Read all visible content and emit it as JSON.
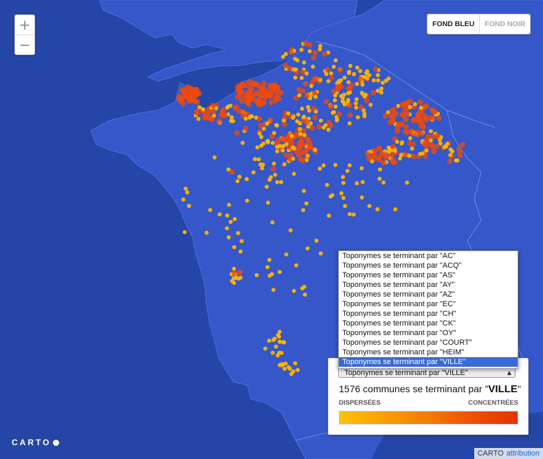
{
  "map": {
    "sea_color": "#2446a8",
    "land_color": "#3557c9",
    "border_color": "#5a7ad8",
    "point_color": "#ffb400",
    "hot_color": "#f04a0a"
  },
  "zoom": {
    "in_label": "+",
    "out_label": "−"
  },
  "basemap_toggle": {
    "active": "FOND BLEU",
    "inactive": "FOND NOIR"
  },
  "legend": {
    "selected": "Toponymes se terminant par \"VILLE\"",
    "count_prefix": "1576 communes se terminant par \"",
    "count_suffix_bold": "VILLE",
    "count_end": "\"",
    "left_label": "DISPERSÉES",
    "right_label": "CONCENTRÉES",
    "ramp_colors": [
      "#ffc300",
      "#fa9f00",
      "#f47a00",
      "#ef4f00",
      "#e63200"
    ]
  },
  "dropdown": {
    "options": [
      "Toponymes se terminant par \"AC\"",
      "Toponymes se terminant par \"ACQ\"",
      "Toponymes se terminant par \"AS\"",
      "Toponymes se terminant par \"AY\"",
      "Toponymes se terminant par \"AZ\"",
      "Toponymes se terminant par \"EC\"",
      "Toponymes se terminant par \"CH\"",
      "Toponymes se terminant par \"CK\"",
      "Toponymes se terminant par \"OY\"",
      "Toponymes se terminant par \"COURT\"",
      "Toponymes se terminant par \"HEIM\"",
      "Toponymes se terminant par \"VILLE\""
    ],
    "selected_index": 11
  },
  "footer": {
    "logo": "CARTO",
    "attribution_brand": "CARTO",
    "attribution_link": "attribution"
  }
}
